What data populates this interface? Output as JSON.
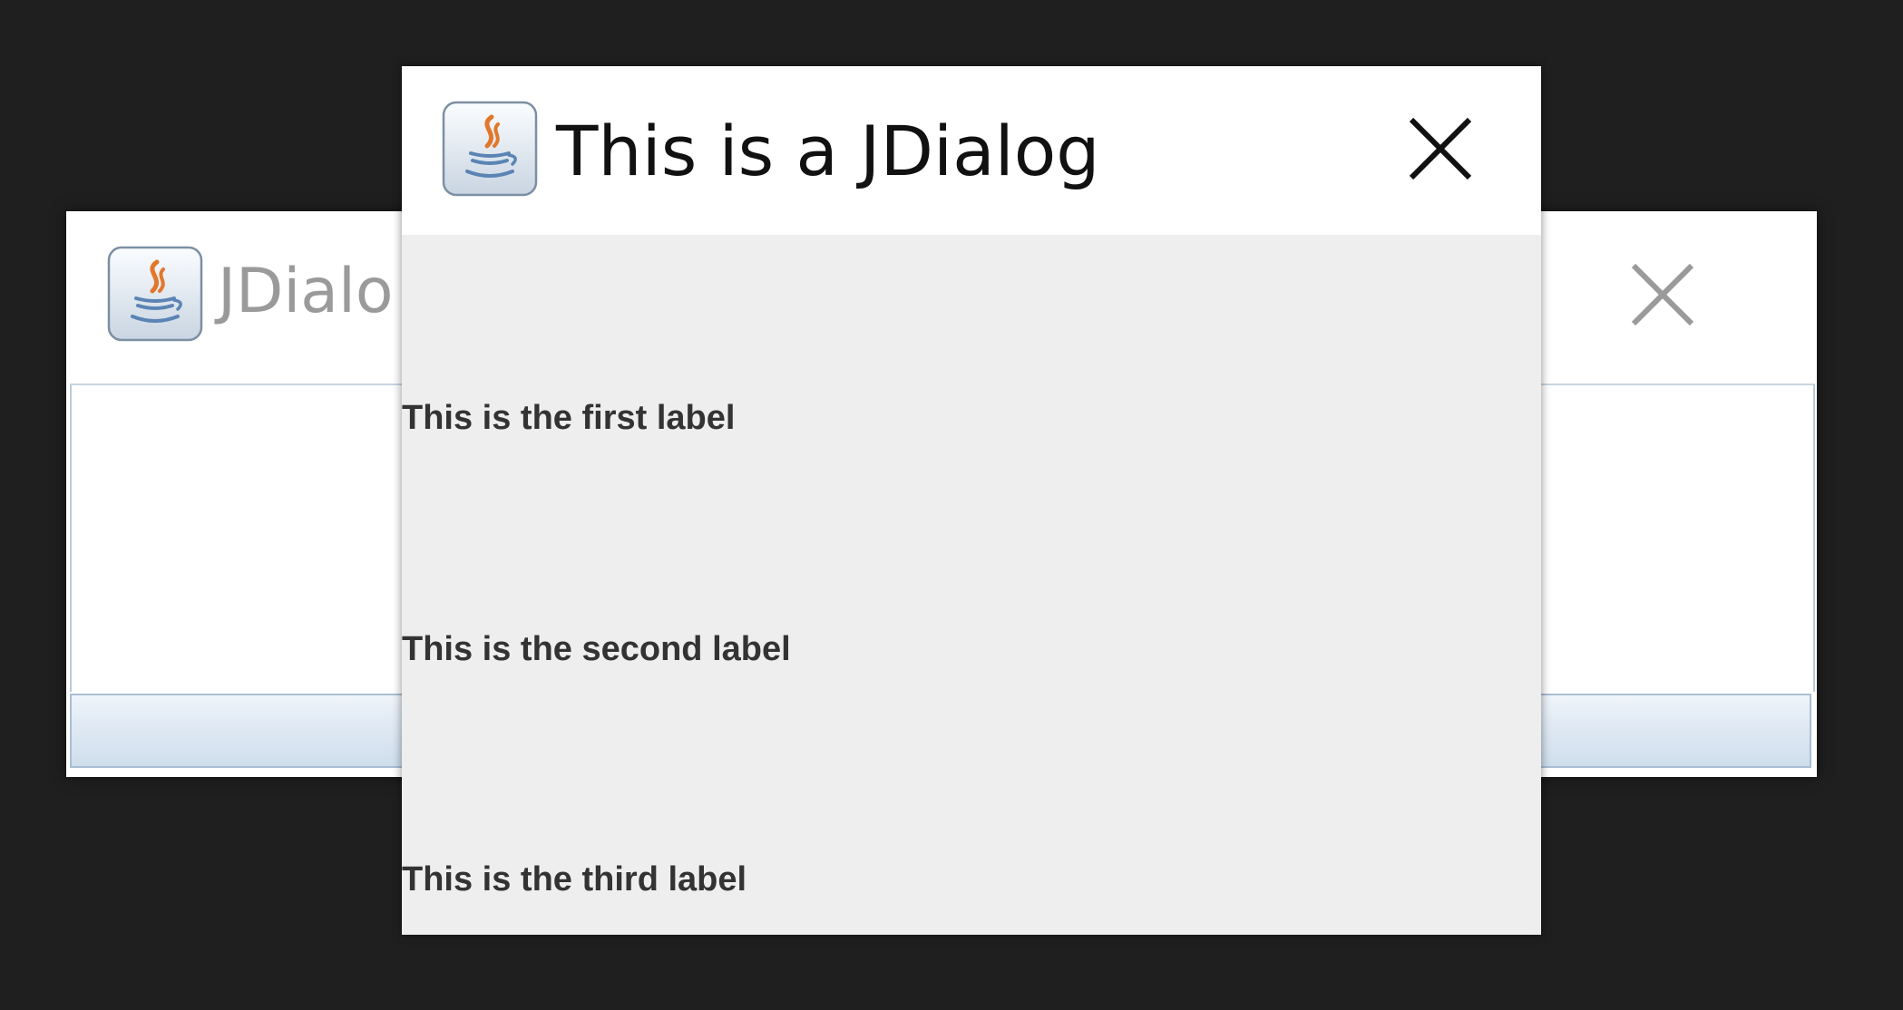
{
  "background_window": {
    "title": "JDialo",
    "icon": "java-coffee-cup-icon",
    "close_icon": "close-icon"
  },
  "dialog": {
    "title": "This is a JDialog",
    "icon": "java-coffee-cup-icon",
    "close_icon": "close-icon",
    "labels": [
      "This is the first label",
      "This is the second label",
      "This is the third label"
    ]
  },
  "colors": {
    "desktop": "#1f1f1f",
    "dialog_body": "#eeeeee",
    "titlebar": "#ffffff",
    "label_text": "#333333",
    "java_orange": "#e2772b",
    "java_blue": "#5b84b5"
  }
}
